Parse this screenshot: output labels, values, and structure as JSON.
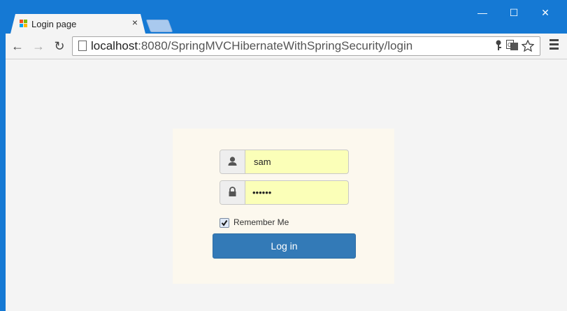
{
  "browser": {
    "tab_title": "Login page",
    "tab_close": "×",
    "window_controls": {
      "minimize": "—",
      "maximize": "☐",
      "close": "✕"
    },
    "nav": {
      "back": "←",
      "forward": "→",
      "reload": "↻"
    },
    "url_host": "localhost",
    "url_path": ":8080/SpringMVCHibernateWithSpringSecurity/login",
    "icons": [
      "key-icon",
      "translate-icon",
      "star-icon",
      "menu-icon"
    ]
  },
  "login": {
    "username_value": "sam",
    "password_value": "••••••",
    "remember_label": "Remember Me",
    "remember_checked": true,
    "submit_label": "Log in"
  },
  "colors": {
    "titlebar": "#1579d4",
    "panel_bg": "#fcf8ee",
    "input_autofill": "#fbffb8",
    "button_primary": "#337ab7"
  }
}
